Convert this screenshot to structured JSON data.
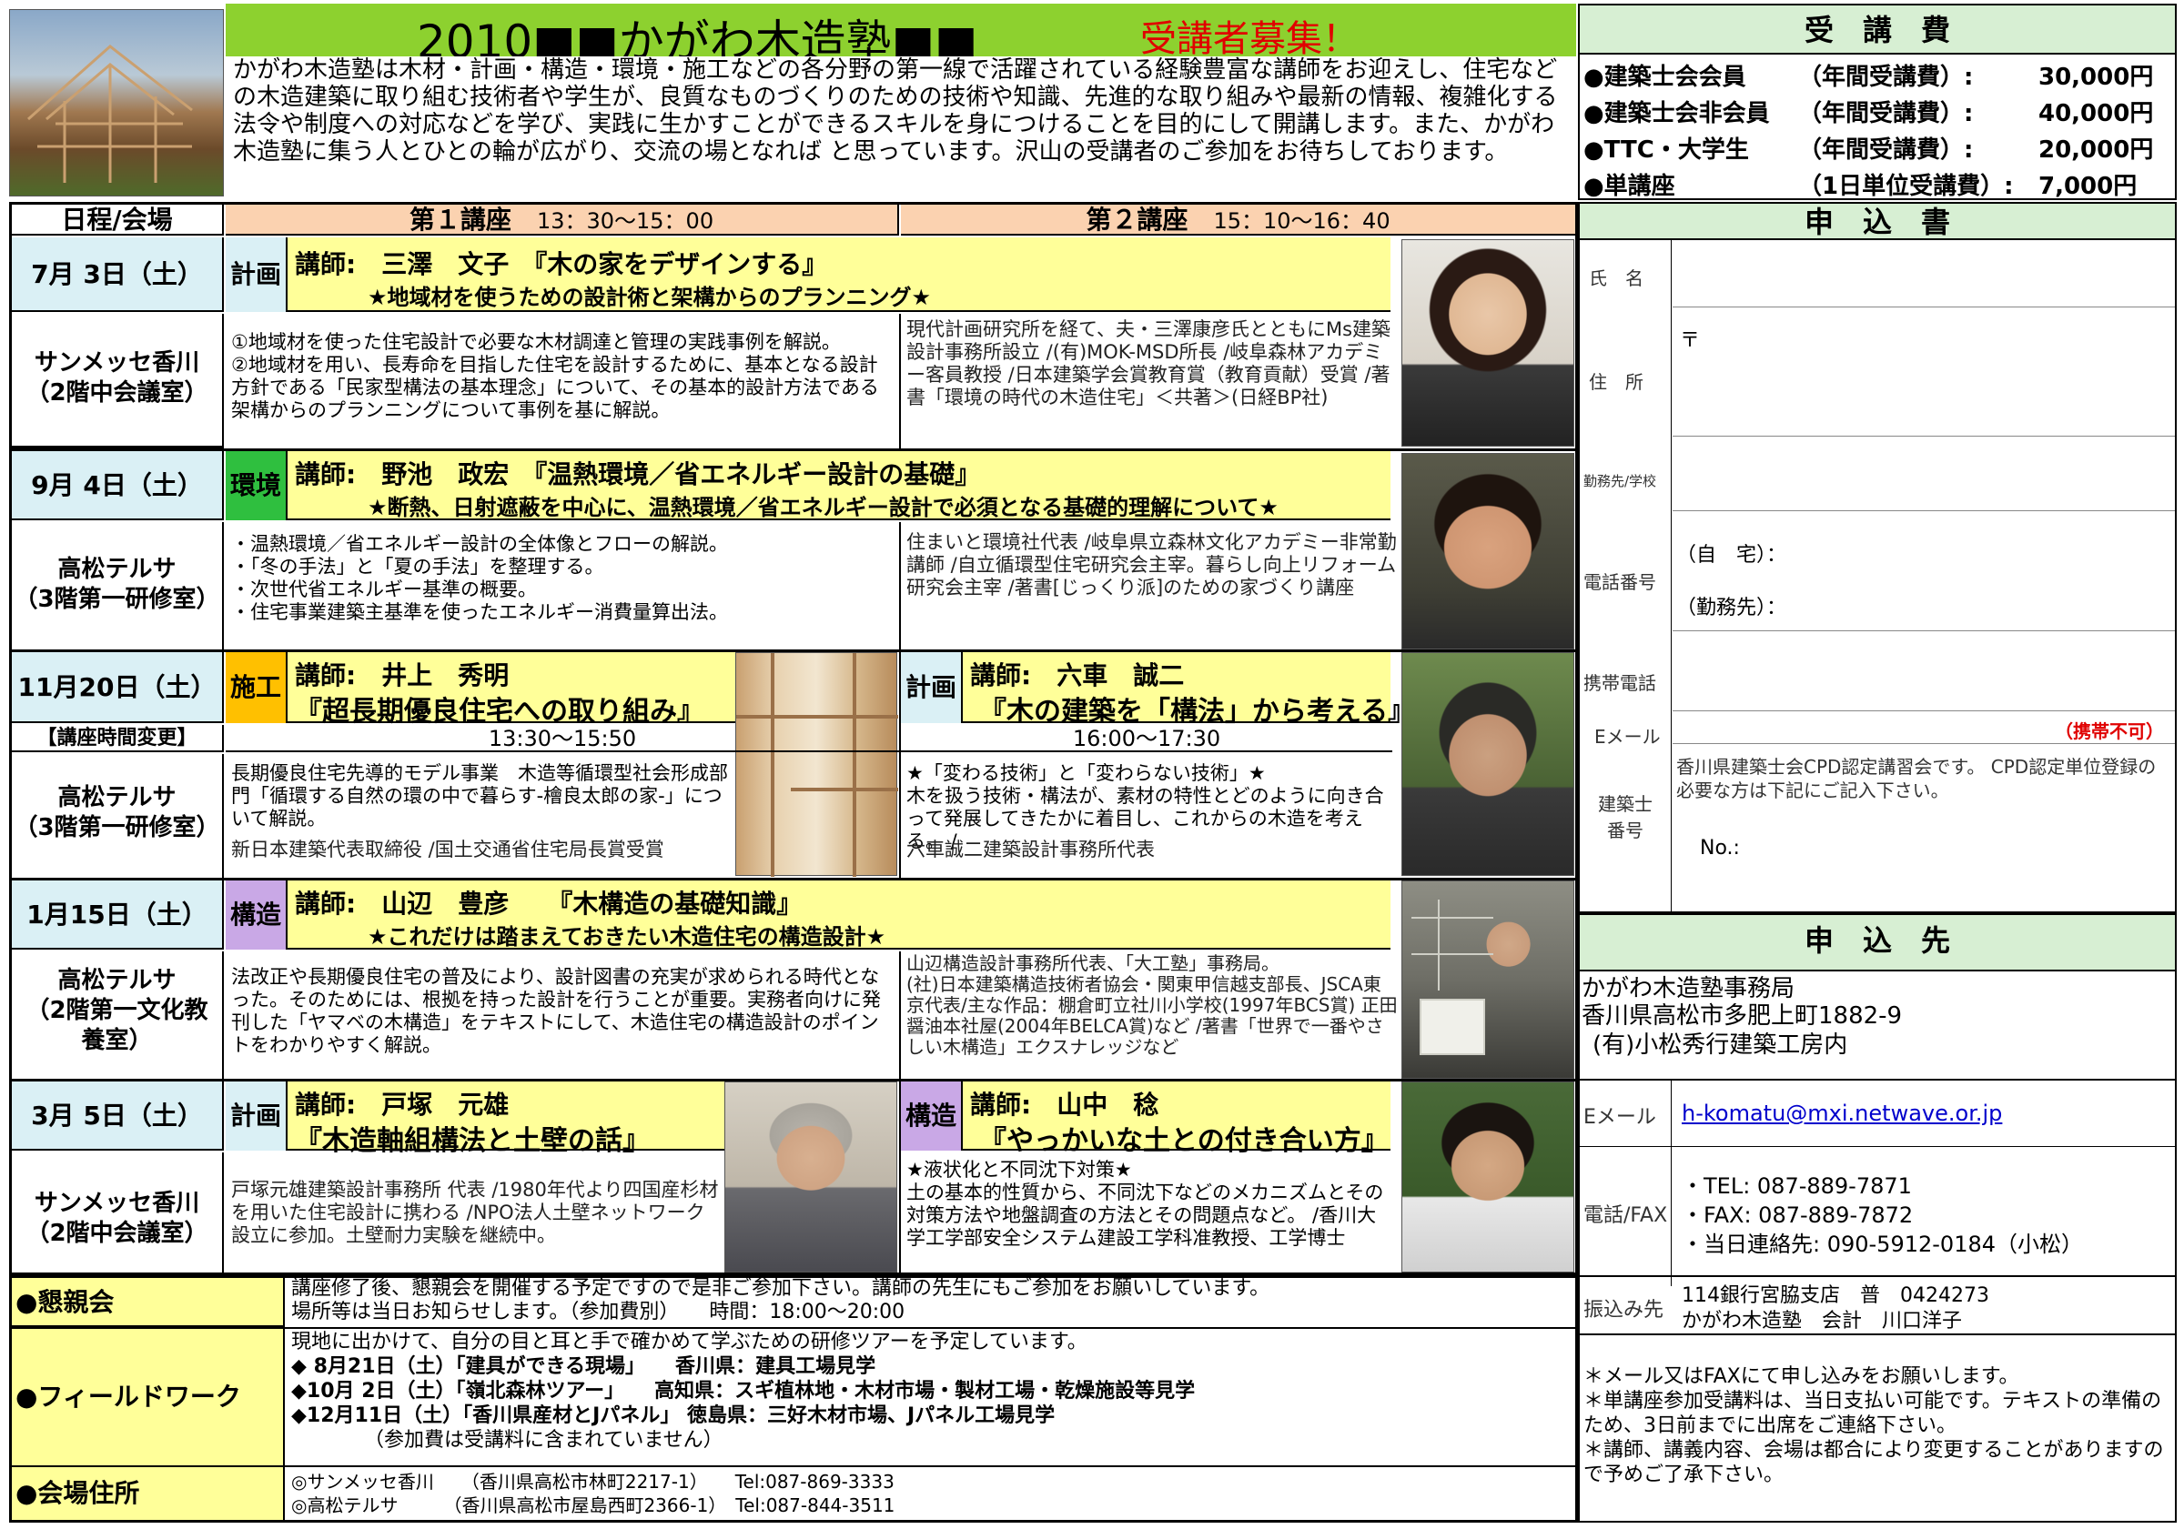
{
  "header": {
    "title": "2010■■かがわ木造塾■■",
    "recruit": "受講者募集！",
    "intro": "かがわ木造塾は木材・計画・構造・環境・施工などの各分野の第一線で活躍されている経験豊富な講師をお迎えし、住宅などの木造建築に取り組む技術者や学生が、良質なものづくりのための技術や知識、先進的な取り組みや最新の情報、複雑化する法令や制度への対応などを学び、実践に生かすことができるスキルを身につけることを目的にして開講します。また、かがわ木造塾に集う人とひとの輪が広がり、交流の場となれば と思っています。沢山の受講者のご参加をお待ちしております。"
  },
  "fees": {
    "title": "受　講　費",
    "items": [
      {
        "label": "●建築士会会員",
        "type": "（年間受講費）:",
        "price": "30,000円"
      },
      {
        "label": "●建築士会非会員",
        "type": "（年間受講費）:",
        "price": "40,000円"
      },
      {
        "label": "●TTC・大学生",
        "type": "（年間受講費）:",
        "price": "20,000円"
      },
      {
        "label": "●単講座",
        "type": "（1日単位受講費）:",
        "price": "7,000円"
      }
    ]
  },
  "table_head": {
    "schedule": "日程/会場",
    "lecture1": "第１講座",
    "time1": "13：30〜15：00",
    "lecture2": "第２講座",
    "time2": "15：10〜16：40"
  },
  "sessions": [
    {
      "date": "7月 3日（土）",
      "venue": "サンメッセ香川\n（2階中会議室）",
      "tag": "計画",
      "lecturer": "講師:　三澤　文子　『木の家をデザインする』",
      "subtitle": "★地域材を使うための設計術と架構からのプランニング★",
      "desc": "①地域材を使った住宅設計で必要な木材調達と管理の実践事例を解説。\n②地域材を用い、長寿命を目指した住宅を設計するために、基本となる設計方針である「民家型構法の基本理念」について、その基本的設計方法である架構からのプランニングについて事例を基に解説。",
      "bio": "現代計画研究所を経て、夫・三澤康彦氏とともにMs建築設計事務所設立 /(有)MOK-MSD所長 /岐阜森林アカデミー客員教授 /日本建築学会賞教育賞（教育貢献）受賞 /著書「環境の時代の木造住宅」＜共著＞(日経BP社)"
    },
    {
      "date": "9月 4日（土）",
      "venue": "高松テルサ\n（3階第一研修室）",
      "tag": "環境",
      "lecturer": "講師:　野池　政宏　『温熱環境／省エネルギー設計の基礎』",
      "subtitle": "★断熱、日射遮蔽を中心に、温熱環境／省エネルギー設計で必須となる基礎的理解について★",
      "desc": "・温熱環境／省エネルギー設計の全体像とフローの解説。\n・「冬の手法」と「夏の手法」を整理する。\n・次世代省エネルギー基準の概要。\n・住宅事業建築主基準を使ったエネルギー消費量算出法。",
      "bio": "住まいと環境社代表 /岐阜県立森林文化アカデミー非常勤講師 /自立循環型住宅研究会主宰。暮らし向上リフォーム研究会主宰 /著書[じっくり派]のための家づくり講座"
    },
    {
      "date": "11月20日（土）",
      "change": "【講座時間変更】",
      "venue": "高松テルサ\n（3階第一研修室）",
      "left": {
        "tag": "施工",
        "lecturer": "講師:　井上　秀明",
        "title": "『超長期優良住宅への取り組み』",
        "time": "13:30〜15:50",
        "desc": "長期優良住宅先導的モデル事業　木造等循環型社会形成部門「循環する自然の環の中で暮らす-檜良太郎の家-」について解説。",
        "bio": "新日本建築代表取締役 /国土交通省住宅局長賞受賞"
      },
      "right": {
        "tag": "計画",
        "lecturer": "講師:　六車　誠二",
        "title": "『木の建築を「構法」から考える』",
        "time": "16:00〜17:30",
        "desc": "★「変わる技術」と「変わらない技術」★\n木を扱う技術・構法が、素材の特性とどのように向き合って発展してきたかに着目し、これからの木造を考える。 /",
        "bio": "六車誠二建築設計事務所代表"
      }
    },
    {
      "date": "1月15日（土）",
      "venue": "高松テルサ\n（2階第一文化教\n養室）",
      "tag": "構造",
      "lecturer": "講師:　山辺　豊彦　　『木構造の基礎知識』",
      "subtitle": "★これだけは踏まえておきたい木造住宅の構造設計★",
      "desc": "法改正や長期優良住宅の普及により、設計図書の充実が求められる時代となった。そのためには、根拠を持った設計を行うことが重要。実務者向けに発刊した「ヤマベの木構造」をテキストにして、木造住宅の構造設計のポイントをわかりやすく解説。",
      "bio": "山辺構造設計事務所代表、「大工塾」事務局。\n(社)日本建築構造技術者協会・関東甲信越支部長、JSCA東京代表/主な作品：棚倉町立社川小学校(1997年BCS賞) 正田醤油本社屋(2004年BELCA賞)など /著書「世界で一番やさしい木構造」エクスナレッジなど"
    },
    {
      "date": "3月 5日（土）",
      "venue": "サンメッセ香川\n（2階中会議室）",
      "left": {
        "tag": "計画",
        "lecturer": "講師:　戸塚　元雄",
        "title": "『木造軸組構法と土壁の話』",
        "desc": "戸塚元雄建築設計事務所 代表 /1980年代より四国産杉材を用いた住宅設計に携わる /NPO法人土壁ネットワーク設立に参加。土壁耐力実験を継続中。"
      },
      "right": {
        "tag": "構造",
        "lecturer": "講師:　山中　稔",
        "title": "『やっかいな土との付き合い方』",
        "desc": "★液状化と不同沈下対策★\n土の基本的性質から、不同沈下などのメカニズムとその対策方法や地盤調査の方法とその問題点など。 /香川大学工学部安全システム建設工学科准教授、工学博士"
      }
    }
  ],
  "social": {
    "label": "●懇親会",
    "text": "講座修了後、懇親会を開催する予定ですので是非ご参加下さい。講師の先生にもご参加をお願いしています。\n場所等は当日お知らせします。（参加費別）　　時間：18:00〜20:00"
  },
  "field": {
    "label": "●フィールドワーク",
    "intro": "現地に出かけて、自分の目と耳と手で確かめて学ぶための研修ツアーを予定しています。",
    "items": [
      "◆  8月21日（土）「建具ができる現場」　　香川県：建具工場見学",
      "◆10月  2日（土）「嶺北森林ツアー」　　高知県：スギ植林地・木材市場・製材工場・乾燥施設等見学",
      "◆12月11日（土）「香川県産材とJパネル」 徳島県：三好木材市場、Jパネル工場見学"
    ],
    "note": "（参加費は受講料に含まれていません）"
  },
  "address": {
    "label": "●会場住所",
    "lines": [
      "◎サンメッセ香川　　（香川県高松市林町2217-1）　　Tel:087-869-3333",
      "◎高松テルサ　　　（香川県高松市屋島西町2366-1）　Tel:087-844-3511"
    ]
  },
  "form": {
    "title": "申　込　書",
    "name": "氏　名",
    "addr": "住　所",
    "postal": "〒",
    "work": "勤務先/学校",
    "phone": "電話番号",
    "home": "（自　宅）：",
    "office": "（勤務先）：",
    "mobile": "携帯電話",
    "email": "Eメール",
    "nomobile": "（携帯不可）",
    "cpd_label": "建築士\n番号",
    "cpd_text": "香川県建築士会CPD認定講習会です。 CPD認定単位登録の必要な方は下記にご記入下さい。",
    "no": "No.:"
  },
  "contact": {
    "title": "申　込　先",
    "org": "かがわ木造塾事務局",
    "addr": "香川県高松市多肥上町1882-9",
    "company": "(有)小松秀行建築工房内",
    "email_label": "Eメール",
    "email": "h-komatu@mxi.netwave.or.jp",
    "tel_label": "電話/FAX",
    "tel": "・TEL:  087-889-7871",
    "fax": "・FAX:  087-889-7872",
    "day": "・当日連絡先:  090-5912-0184（小松）",
    "bank_label": "振込み先",
    "bank1": "114銀行宮脇支店　普　0424273",
    "bank2": "かがわ木造塾　会計　川口洋子",
    "notes": "＊メール又はFAXにて申し込みをお願いします。\n＊単講座参加受講料は、当日支払い可能です。テキストの準備のため、3日前までに出席をご連絡下さい。\n＊講師、講義内容、会場は都合により変更することがありますので予めご了承下さい。"
  }
}
